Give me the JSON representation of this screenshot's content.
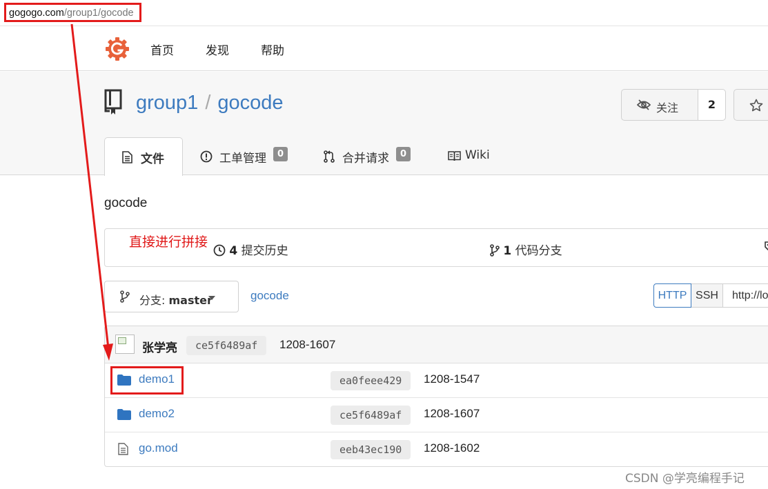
{
  "address_bar": {
    "host": "gogogo.com",
    "path": "/group1/gocode"
  },
  "nav": {
    "items": [
      "首页",
      "发现",
      "帮助"
    ]
  },
  "repo": {
    "owner": "group1",
    "separator": "/",
    "name": "gocode",
    "watch_label": "关注",
    "watch_count": "2",
    "description": "gocode"
  },
  "tabs": [
    {
      "label": "文件",
      "icon": "file-text-icon"
    },
    {
      "label": "工单管理",
      "badge": "0",
      "icon": "issue-opened-icon"
    },
    {
      "label": "合并请求",
      "badge": "0",
      "icon": "git-pull-request-icon"
    },
    {
      "label": "Wiki",
      "icon": "book-icon"
    }
  ],
  "annotation": "直接进行拼接",
  "stats": {
    "commits_count": "4",
    "commits_label": "提交历史",
    "branches_count": "1",
    "branches_label": "代码分支"
  },
  "branch": {
    "prefix": "分支:",
    "name": "master"
  },
  "breadcrumb": "gocode",
  "clone": {
    "http": "HTTP",
    "ssh": "SSH",
    "url": "http://lo"
  },
  "latest_commit": {
    "author": "张学亮",
    "sha": "ce5f6489af",
    "message": "1208-1607"
  },
  "files": [
    {
      "name": "demo1",
      "type": "folder",
      "sha": "ea0feee429",
      "message": "1208-1547"
    },
    {
      "name": "demo2",
      "type": "folder",
      "sha": "ce5f6489af",
      "message": "1208-1607"
    },
    {
      "name": "go.mod",
      "type": "file",
      "sha": "eeb43ec190",
      "message": "1208-1602"
    }
  ],
  "watermark": "CSDN @学亮编程手记",
  "colors": {
    "link": "#3d7bbf",
    "annotation": "#e31b1b",
    "logo": "#e8613a"
  }
}
